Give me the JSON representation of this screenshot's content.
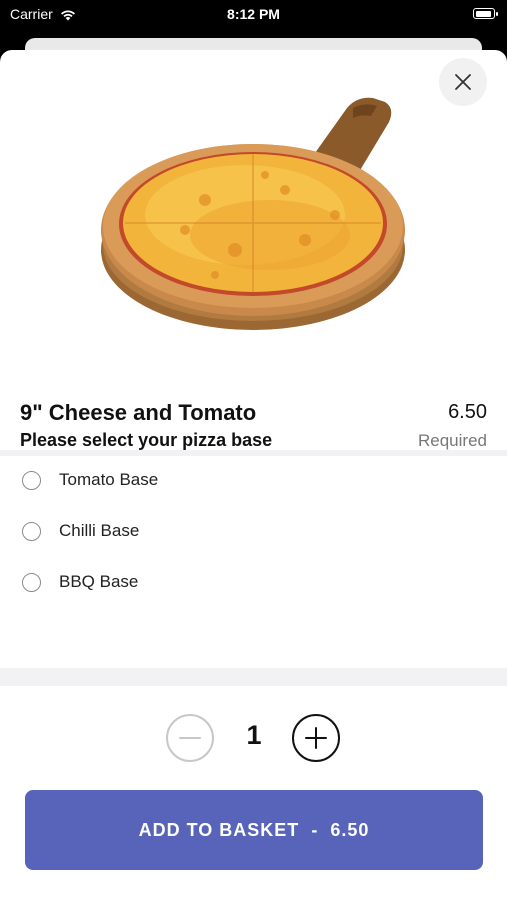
{
  "status_bar": {
    "carrier": "Carrier",
    "time": "8:12 PM"
  },
  "product": {
    "image_icon": "pizza-image",
    "title": "9\" Cheese and Tomato",
    "price": "6.50"
  },
  "options": {
    "title": "Please select your pizza base",
    "required_label": "Required",
    "items": [
      {
        "label": "Tomato Base"
      },
      {
        "label": "Chilli Base"
      },
      {
        "label": "BBQ Base"
      }
    ]
  },
  "quantity": {
    "value": "1"
  },
  "cta": {
    "label": "ADD TO BASKET",
    "separator": "-",
    "price": "6.50"
  },
  "colors": {
    "accent": "#5764b9",
    "background": "#ffffff",
    "divider": "#f2f2f4"
  }
}
